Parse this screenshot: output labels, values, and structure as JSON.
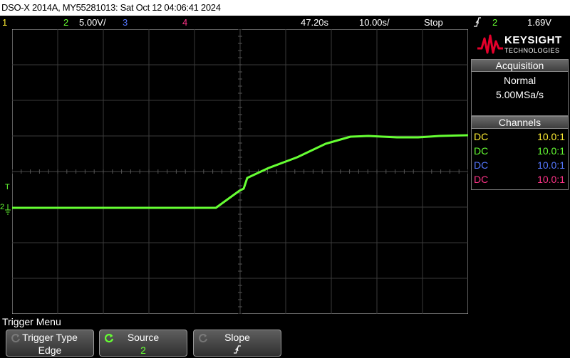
{
  "title": "DSO-X 2014A, MY55281013: Sat Oct 12 04:06:41 2024",
  "status": {
    "ch1_num": "1",
    "ch2_num": "2",
    "ch2_scale": "5.00V/",
    "ch3_num": "3",
    "ch4_num": "4",
    "trigger_pos": "47.20s",
    "timebase": "10.00s/",
    "run_state": "Stop",
    "trigger_slope_icon": "rising-edge",
    "trigger_source": "2",
    "trigger_level": "1.69V"
  },
  "brand": {
    "name": "KEYSIGHT",
    "sub": "TECHNOLOGIES"
  },
  "acquisition": {
    "header": "Acquisition",
    "mode": "Normal",
    "rate": "5.00MSa/s"
  },
  "channels": {
    "header": "Channels",
    "rows": [
      {
        "coupling": "DC",
        "probe": "10.0:1",
        "color": "#ffee33"
      },
      {
        "coupling": "DC",
        "probe": "10.0:1",
        "color": "#66ff33"
      },
      {
        "coupling": "DC",
        "probe": "10.0:1",
        "color": "#5577ff"
      },
      {
        "coupling": "DC",
        "probe": "10.0:1",
        "color": "#ff3388"
      }
    ]
  },
  "markers": {
    "trigger": "T",
    "ch2": "2"
  },
  "menu": {
    "title": "Trigger Menu",
    "softkeys": [
      {
        "top": "Trigger Type",
        "value": "Edge"
      },
      {
        "top": "Source",
        "value": "2"
      },
      {
        "top": "Slope",
        "value": "∱"
      }
    ]
  },
  "colors": {
    "ch1": "#ffee33",
    "ch2": "#66ff33",
    "ch3": "#5577ff",
    "ch4": "#ff3388",
    "trigger_marker": "#ff9900",
    "grid": "#3a3a3a"
  }
}
